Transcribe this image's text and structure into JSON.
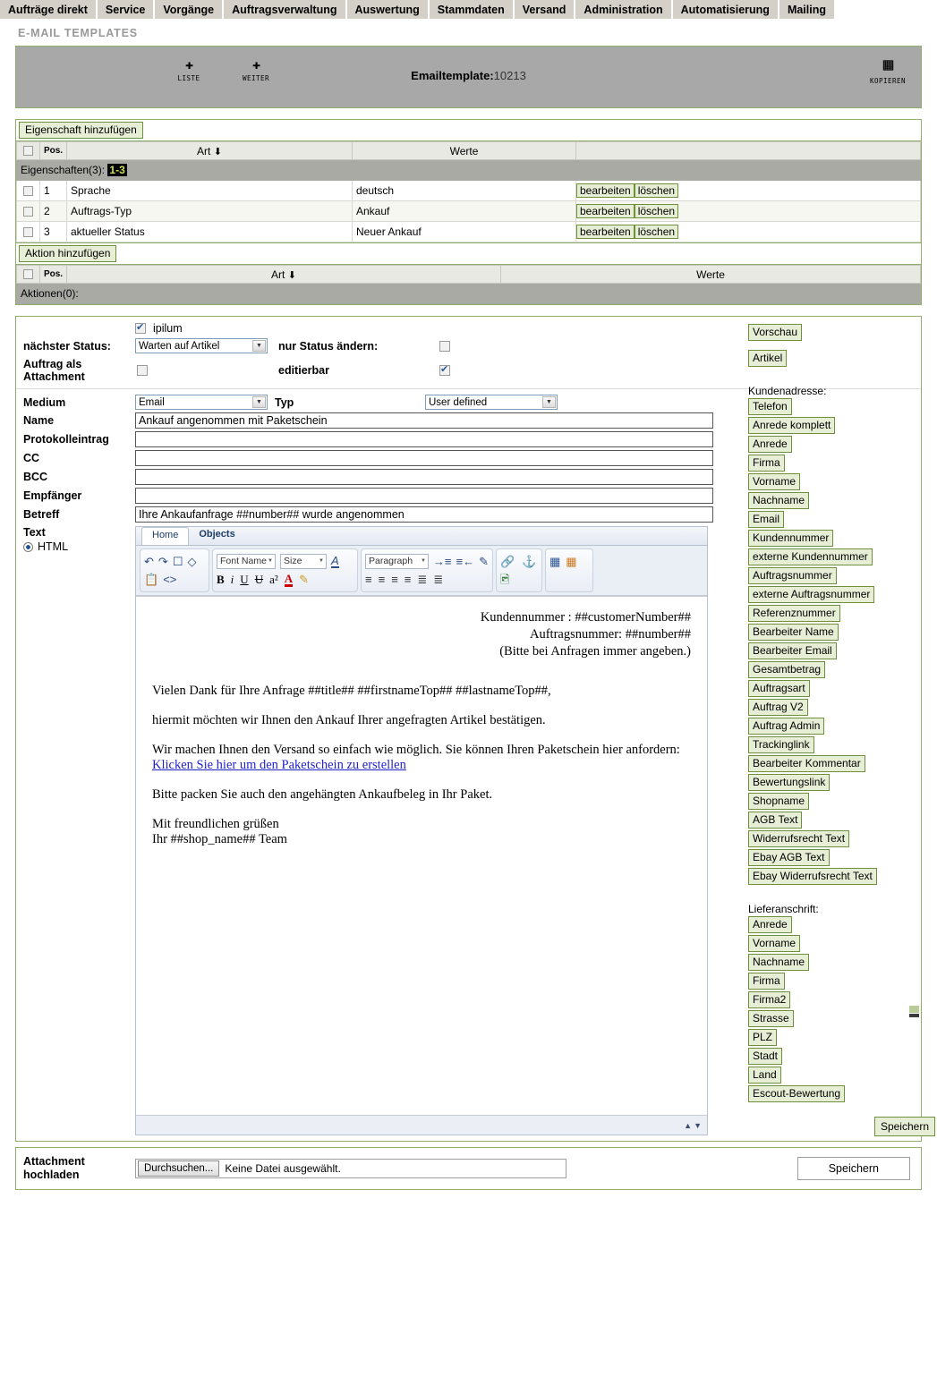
{
  "nav": {
    "items": [
      {
        "label": "Aufträge direkt"
      },
      {
        "label": "Service"
      },
      {
        "label": "Vorgänge"
      },
      {
        "label": "Auftragsverwaltung"
      },
      {
        "label": "Auswertung"
      },
      {
        "label": "Stammdaten"
      },
      {
        "label": "Versand"
      },
      {
        "label": "Administration"
      },
      {
        "label": "Automatisierung"
      },
      {
        "label": "Mailing"
      }
    ]
  },
  "page": {
    "title": "E-MAIL TEMPLATES"
  },
  "commandbar": {
    "liste_label": "LISTE",
    "weiter_label": "WEITER",
    "kopieren_label": "KOPIEREN",
    "title_prefix": "Emailtemplate:",
    "title_id": "10213"
  },
  "properties_table": {
    "add_label": "Eigenschaft hinzufügen",
    "columns": [
      "",
      "Pos.",
      "Art",
      "Werte",
      ""
    ],
    "band_label": "Eigenschaften(3):",
    "band_range": "1-3",
    "edit_label": "bearbeiten",
    "delete_label": "löschen",
    "rows": [
      {
        "pos": "1",
        "art": "Sprache",
        "werte": "deutsch"
      },
      {
        "pos": "2",
        "art": "Auftrags-Typ",
        "werte": "Ankauf"
      },
      {
        "pos": "3",
        "art": "aktueller Status",
        "werte": "Neuer Ankauf"
      }
    ]
  },
  "actions_table": {
    "add_label": "Aktion hinzufügen",
    "columns": [
      "",
      "Pos.",
      "Art",
      "Werte"
    ],
    "band_label": "Aktionen(0):"
  },
  "form": {
    "ipilum_label": "ipilum",
    "ipilum_checked": true,
    "next_status_label": "nächster Status:",
    "next_status_value": "Warten auf Artikel",
    "only_status_label": "nur Status ändern:",
    "only_status_checked": false,
    "attachment_label": "Auftrag als Attachment",
    "attachment_checked": false,
    "editable_label": "editierbar",
    "editable_checked": true,
    "medium_label": "Medium",
    "medium_value": "Email",
    "typ_label": "Typ",
    "typ_value": "User defined",
    "fields": [
      {
        "label": "Name",
        "value": "Ankauf angenommen mit Paketschein"
      },
      {
        "label": "Protokolleintrag",
        "value": ""
      },
      {
        "label": "CC",
        "value": ""
      },
      {
        "label": "BCC",
        "value": ""
      },
      {
        "label": "Empfänger",
        "value": ""
      },
      {
        "label": "Betreff",
        "value": "Ihre Ankaufanfrage ##number## wurde angenommen"
      }
    ],
    "text_label": "Text",
    "html_label": "HTML",
    "html_selected": true
  },
  "editor": {
    "tabs": [
      {
        "label": "Home",
        "active": true
      },
      {
        "label": "Objects",
        "active": false
      }
    ],
    "font_name_placeholder": "Font Name",
    "size_placeholder": "Size",
    "paragraph_placeholder": "Paragraph",
    "content": {
      "header_lines": [
        "Kundennummer : ##customerNumber##",
        "Auftragsnummer: ##number##",
        "(Bitte bei Anfragen immer angeben.)"
      ],
      "p1": "Vielen Dank für Ihre Anfrage ##title## ##firstnameTop## ##lastnameTop##,",
      "p2": "hiermit möchten wir Ihnen den Ankauf Ihrer angefragten Artikel bestätigen.",
      "p3_before": "Wir machen Ihnen den Versand so einfach wie möglich. Sie können Ihren Paketschein hier anfordern: ",
      "p3_link": "Klicken Sie hier um den Paketschein zu erstellen",
      "p4": "Bitte packen Sie auch den angehängten Ankaufbeleg in Ihr Paket.",
      "p5_line1": "Mit freundlichen grüßen",
      "p5_line2": "Ihr ##shop_name## Team"
    }
  },
  "tags": {
    "vorschau": "Vorschau",
    "artikel": "Artikel",
    "kundenadresse_head": "Kundenadresse:",
    "kundenadresse": [
      "Telefon",
      "Anrede komplett",
      "Anrede",
      "Firma",
      "Vorname",
      "Nachname",
      "Email",
      "Kundennummer",
      "externe Kundennummer",
      "Auftragsnummer",
      "externe Auftragsnummer",
      "Referenznummer",
      "Bearbeiter Name",
      "Bearbeiter Email",
      "Gesamtbetrag",
      "Auftragsart",
      "Auftrag V2",
      "Auftrag Admin",
      "Trackinglink",
      "Bearbeiter Kommentar",
      "Bewertungslink",
      "Shopname",
      "AGB Text",
      "Widerrufsrecht Text",
      "Ebay AGB Text",
      "Ebay Widerrufsrecht Text"
    ],
    "lieferanschrift_head": "Lieferanschrift:",
    "lieferanschrift": [
      "Anrede",
      "Vorname",
      "Nachname",
      "Firma",
      "Firma2",
      "Strasse",
      "PLZ",
      "Stadt",
      "Land",
      "Escout-Bewertung"
    ],
    "save_label": "Speichern"
  },
  "attachment": {
    "label_line1": "Attachment",
    "label_line2": "hochladen",
    "browse_label": "Durchsuchen...",
    "file_status": "Keine Datei ausgewählt.",
    "save_label": "Speichern"
  }
}
